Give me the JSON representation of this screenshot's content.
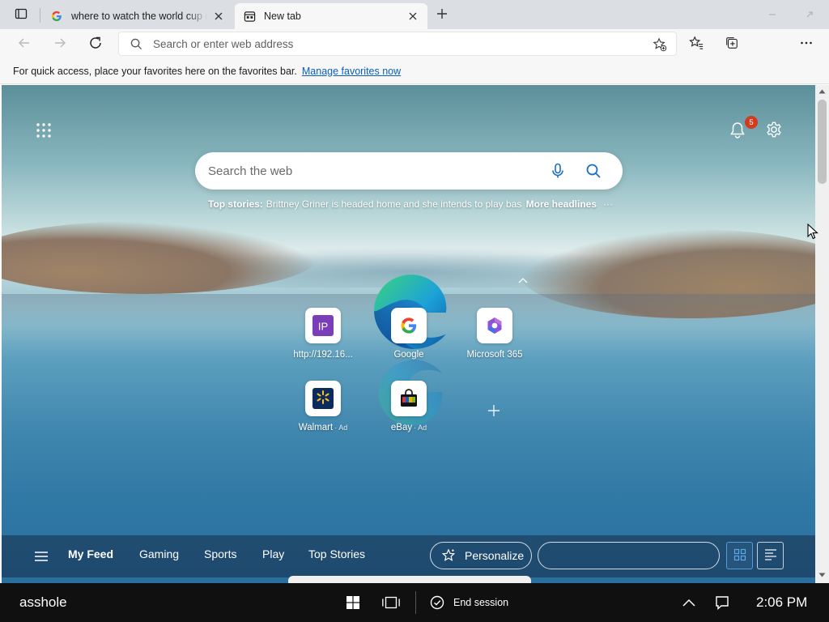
{
  "colors": {
    "accent": "#0a5ebd",
    "badge": "#d13b1f",
    "taskbar": "#101010",
    "tabstrip": "#dbdfe3"
  },
  "browser": {
    "tabs": [
      {
        "title": "where to watch the world cup ne",
        "favicon": "google-g-icon",
        "active": false
      },
      {
        "title": "New tab",
        "favicon": "new-tab-page-icon",
        "active": true
      }
    ],
    "address": {
      "placeholder": "Search or enter web address",
      "value": ""
    },
    "favorites_bar": {
      "message": "For quick access, place your favorites here on the favorites bar.",
      "link": "Manage favorites now"
    }
  },
  "newtab": {
    "notification_count": "5",
    "search": {
      "placeholder": "Search the web"
    },
    "top_stories": {
      "label": "Top stories:",
      "headline": "Brittney Griner is headed home and she intends to play bas...",
      "more": "More headlines",
      "dots": "···"
    },
    "quick_links": [
      {
        "label": "http://192.16...",
        "ad": "",
        "icon": "ip-icon"
      },
      {
        "label": "Google",
        "ad": "",
        "icon": "google-g-icon"
      },
      {
        "label": "Microsoft 365",
        "ad": "",
        "icon": "microsoft-365-icon"
      },
      {
        "label": "Walmart",
        "ad": "· Ad",
        "icon": "walmart-icon"
      },
      {
        "label": "eBay",
        "ad": "· Ad",
        "icon": "ebay-icon"
      }
    ],
    "feed": {
      "tabs": [
        "My Feed",
        "Gaming",
        "Sports",
        "Play",
        "Top Stories"
      ],
      "active_tab": "My Feed",
      "personalize": "Personalize",
      "layout_selected": "grid"
    }
  },
  "taskbar": {
    "user": "asshole",
    "end_session": "End session",
    "time": "2:06 PM"
  }
}
